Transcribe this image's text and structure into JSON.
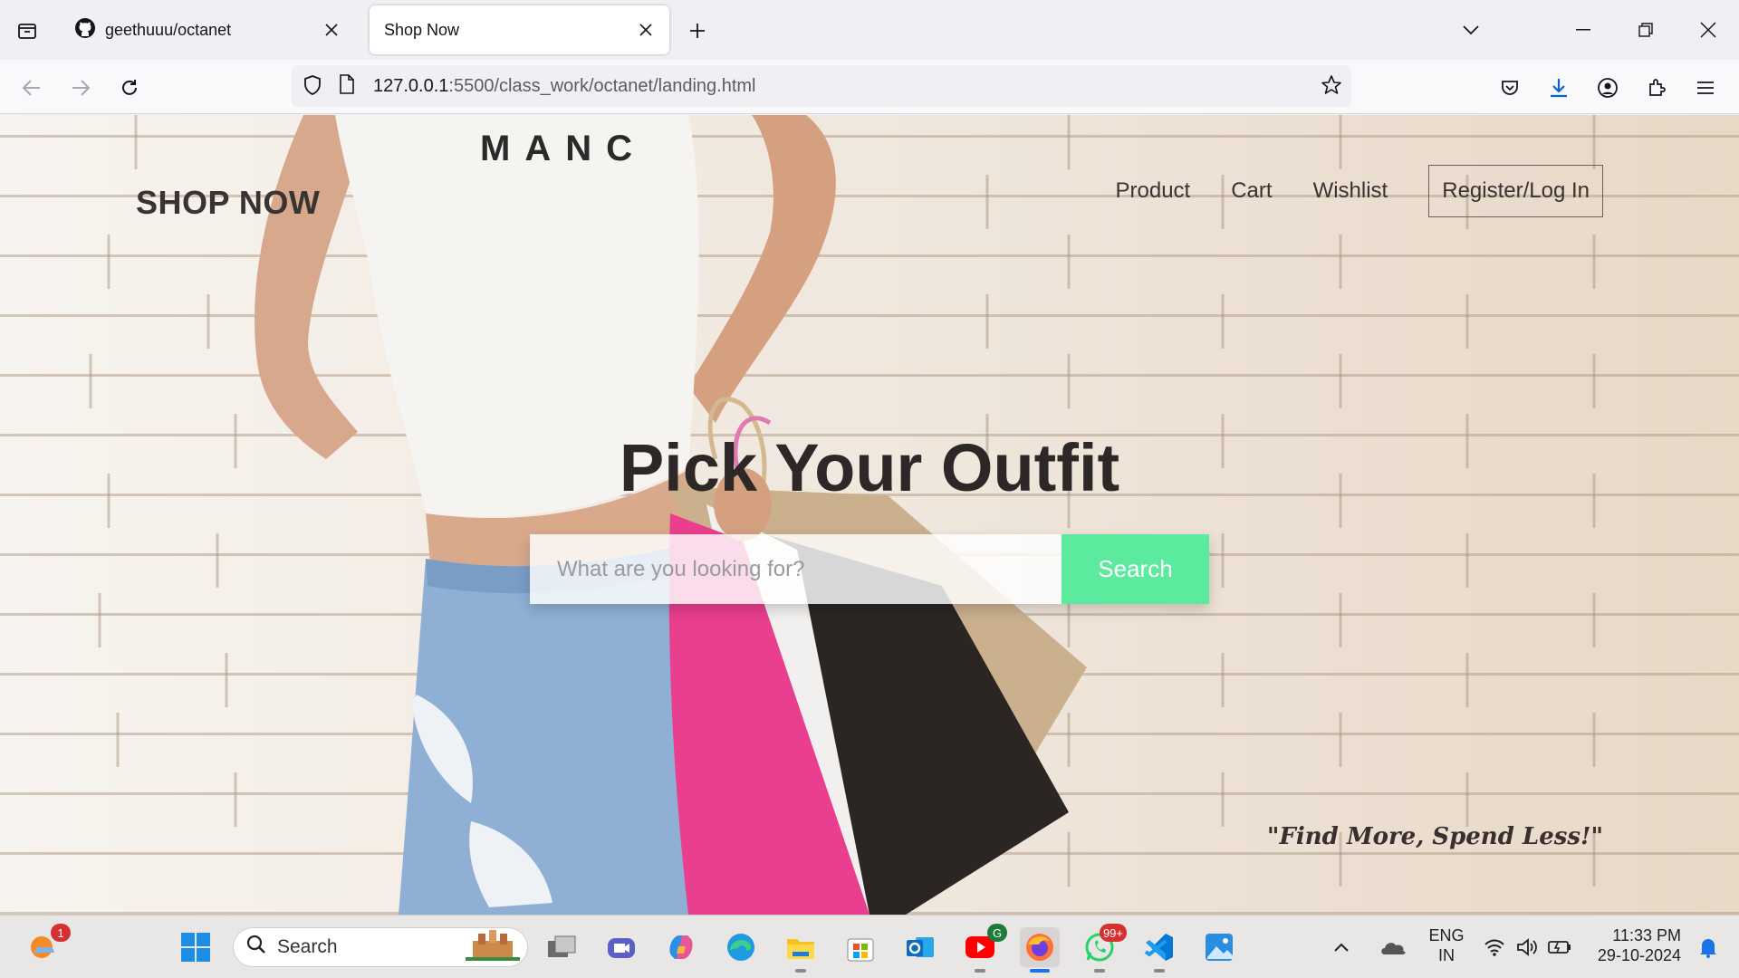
{
  "browser": {
    "tabs": [
      {
        "title": "geethuuu/octanet",
        "active": false,
        "icon": "github-icon"
      },
      {
        "title": "Shop Now",
        "active": true,
        "icon": ""
      }
    ],
    "url_host": "127.0.0.1",
    "url_rest": ":5500/class_work/octanet/landing.html"
  },
  "site": {
    "logo": "SHOP NOW",
    "nav": {
      "product": "Product",
      "cart": "Cart",
      "wishlist": "Wishlist",
      "register": "Register/Log In"
    },
    "hero_title": "Pick Your Outfit",
    "search_placeholder": "What are you looking for?",
    "search_button": "Search",
    "tagline": "\"Find More, Spend Less!\"",
    "shirt_text": "MANC"
  },
  "taskbar": {
    "search_label": "Search",
    "weather_badge": "1",
    "whatsapp_badge": "99+",
    "youtube_badge": "G",
    "language_line1": "ENG",
    "language_line2": "IN",
    "time": "11:33 PM",
    "date": "29-10-2024"
  },
  "colors": {
    "search_button": "#5cea9f",
    "text_dark": "#3a3333",
    "browser_bg": "#f0f0f4"
  }
}
